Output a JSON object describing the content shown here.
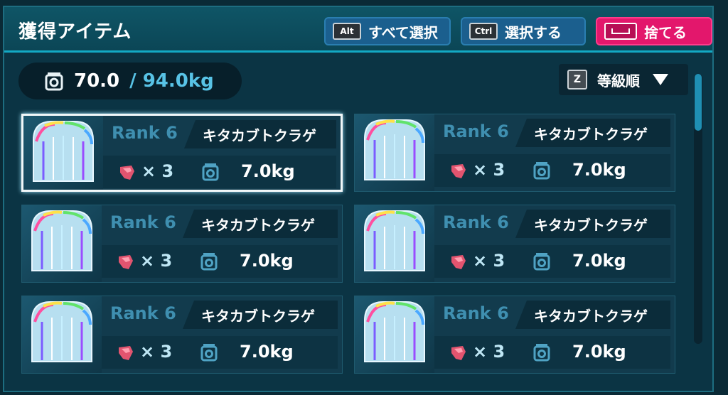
{
  "header": {
    "title": "獲得アイテム",
    "buttons": [
      {
        "key": "Alt",
        "label": "すべて選択"
      },
      {
        "key": "Ctrl",
        "label": "選択する"
      },
      {
        "key": "space",
        "label": "捨てる"
      }
    ]
  },
  "weight": {
    "current": "70.0",
    "max": "/ 94.0kg"
  },
  "sort": {
    "key": "Z",
    "label": "等級順"
  },
  "items": [
    {
      "rank": "Rank 6",
      "name": "キタカブトクラゲ",
      "qty": "× 3",
      "weight": "7.0kg",
      "selected": true
    },
    {
      "rank": "Rank 6",
      "name": "キタカブトクラゲ",
      "qty": "× 3",
      "weight": "7.0kg",
      "selected": false
    },
    {
      "rank": "Rank 6",
      "name": "キタカブトクラゲ",
      "qty": "× 3",
      "weight": "7.0kg",
      "selected": false
    },
    {
      "rank": "Rank 6",
      "name": "キタカブトクラゲ",
      "qty": "× 3",
      "weight": "7.0kg",
      "selected": false
    },
    {
      "rank": "Rank 6",
      "name": "キタカブトクラゲ",
      "qty": "× 3",
      "weight": "7.0kg",
      "selected": false
    },
    {
      "rank": "Rank 6",
      "name": "キタカブトクラゲ",
      "qty": "× 3",
      "weight": "7.0kg",
      "selected": false
    }
  ],
  "icons": {
    "weight": "scale-icon",
    "gem": "gem-icon",
    "sort": "triangle-down-icon",
    "item": "jellyfish-icon"
  },
  "colors": {
    "accent": "#13a9c4",
    "discard": "#e3176c",
    "rank": "#3f8fb0",
    "max_weight": "#58c3e6"
  }
}
